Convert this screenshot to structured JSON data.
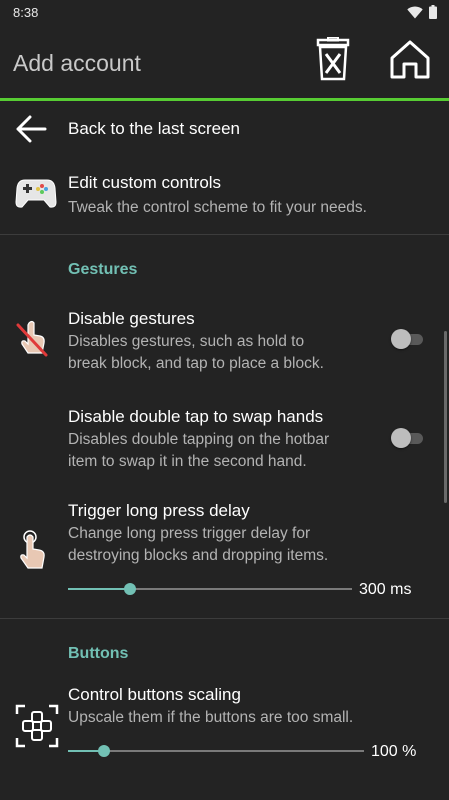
{
  "status_bar": {
    "time": "8:38"
  },
  "toolbar": {
    "title": "Add account",
    "delete_icon": "delete-icon",
    "home_icon": "home-icon",
    "accent_color": "#57cc33"
  },
  "items": {
    "back": {
      "title": "Back to the last screen"
    },
    "custom_controls": {
      "title": "Edit custom controls",
      "summary": "Tweak the control scheme to fit your needs."
    }
  },
  "gestures": {
    "header": "Gestures",
    "disable_gestures": {
      "title": "Disable gestures",
      "summary_line1": "Disables gestures, such as hold to",
      "summary_line2": "break block, and tap to place a block.",
      "enabled": false
    },
    "disable_double_tap": {
      "title": "Disable double tap to swap hands",
      "summary_line1": "Disables double tapping on the hotbar",
      "summary_line2": "item to swap it in the second hand.",
      "enabled": false
    },
    "long_press": {
      "title": "Trigger long press delay",
      "summary_line1": "Change long press trigger delay for",
      "summary_line2": "destroying blocks and dropping items.",
      "value_label": "300 ms",
      "fraction": 0.22
    }
  },
  "buttons": {
    "header": "Buttons",
    "scaling": {
      "title": "Control buttons scaling",
      "summary": "Upscale them if the buttons are too small.",
      "value_label": "100 %",
      "fraction": 0.12
    }
  },
  "accent_color": "#72c0b4"
}
